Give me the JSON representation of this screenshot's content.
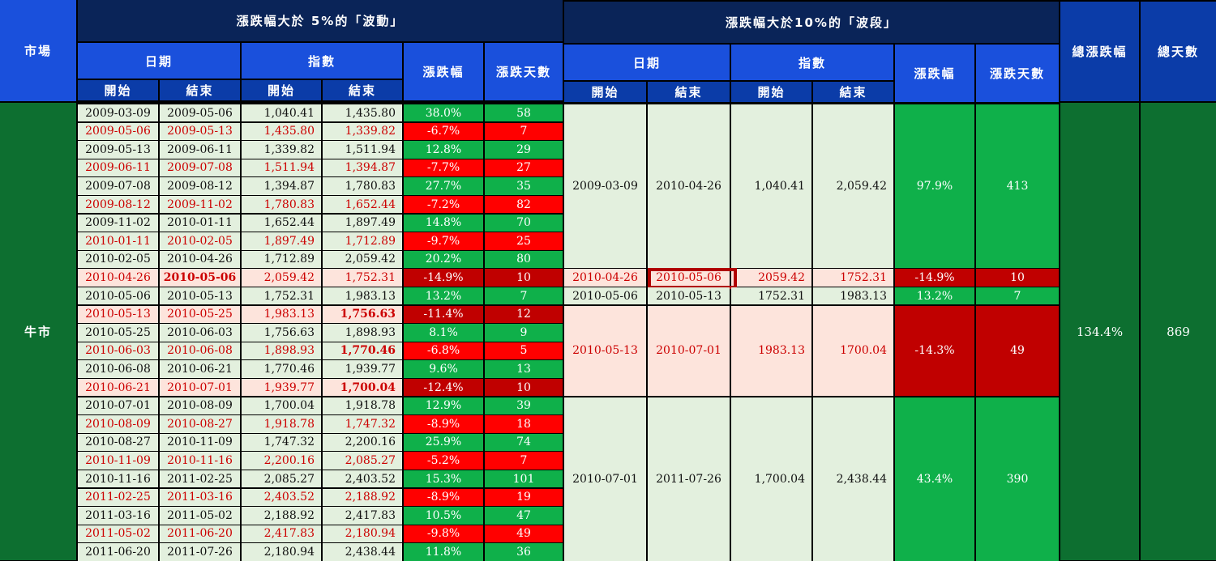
{
  "header": {
    "market": "市場",
    "left_group": "漲跌幅大於 5%的「波動」",
    "right_group": "漲跌幅大於10%的「波段」",
    "date": "日期",
    "index": "指數",
    "change": "漲跌幅",
    "days": "漲跌天數",
    "start": "開始",
    "end": "結束",
    "total_change": "總漲跌幅",
    "total_days": "總天數"
  },
  "market_label": "牛市",
  "totals": {
    "change": "134.4%",
    "days": "869"
  },
  "left_rows": [
    {
      "s": "2009-03-09",
      "e": "2009-05-06",
      "is": "1,040.41",
      "ie": "1,435.80",
      "chg": "38.0%",
      "d": "58",
      "type": "up"
    },
    {
      "s": "2009-05-06",
      "e": "2009-05-13",
      "is": "1,435.80",
      "ie": "1,339.82",
      "chg": "-6.7%",
      "d": "7",
      "type": "down"
    },
    {
      "s": "2009-05-13",
      "e": "2009-06-11",
      "is": "1,339.82",
      "ie": "1,511.94",
      "chg": "12.8%",
      "d": "29",
      "type": "up"
    },
    {
      "s": "2009-06-11",
      "e": "2009-07-08",
      "is": "1,511.94",
      "ie": "1,394.87",
      "chg": "-7.7%",
      "d": "27",
      "type": "down"
    },
    {
      "s": "2009-07-08",
      "e": "2009-08-12",
      "is": "1,394.87",
      "ie": "1,780.83",
      "chg": "27.7%",
      "d": "35",
      "type": "up"
    },
    {
      "s": "2009-08-12",
      "e": "2009-11-02",
      "is": "1,780.83",
      "ie": "1,652.44",
      "chg": "-7.2%",
      "d": "82",
      "type": "down"
    },
    {
      "s": "2009-11-02",
      "e": "2010-01-11",
      "is": "1,652.44",
      "ie": "1,897.49",
      "chg": "14.8%",
      "d": "70",
      "type": "up"
    },
    {
      "s": "2010-01-11",
      "e": "2010-02-05",
      "is": "1,897.49",
      "ie": "1,712.89",
      "chg": "-9.7%",
      "d": "25",
      "type": "down"
    },
    {
      "s": "2010-02-05",
      "e": "2010-04-26",
      "is": "1,712.89",
      "ie": "2,059.42",
      "chg": "20.2%",
      "d": "80",
      "type": "up"
    },
    {
      "s": "2010-04-26",
      "e": "2010-05-06",
      "is": "2,059.42",
      "ie": "1,752.31",
      "chg": "-14.9%",
      "d": "10",
      "type": "big",
      "bold": "e"
    },
    {
      "s": "2010-05-06",
      "e": "2010-05-13",
      "is": "1,752.31",
      "ie": "1,983.13",
      "chg": "13.2%",
      "d": "7",
      "type": "up"
    },
    {
      "s": "2010-05-13",
      "e": "2010-05-25",
      "is": "1,983.13",
      "ie": "1,756.63",
      "chg": "-11.4%",
      "d": "12",
      "type": "big",
      "bold": "ie"
    },
    {
      "s": "2010-05-25",
      "e": "2010-06-03",
      "is": "1,756.63",
      "ie": "1,898.93",
      "chg": "8.1%",
      "d": "9",
      "type": "up"
    },
    {
      "s": "2010-06-03",
      "e": "2010-06-08",
      "is": "1,898.93",
      "ie": "1,770.46",
      "chg": "-6.8%",
      "d": "5",
      "type": "down",
      "bold": "ie"
    },
    {
      "s": "2010-06-08",
      "e": "2010-06-21",
      "is": "1,770.46",
      "ie": "1,939.77",
      "chg": "9.6%",
      "d": "13",
      "type": "up"
    },
    {
      "s": "2010-06-21",
      "e": "2010-07-01",
      "is": "1,939.77",
      "ie": "1,700.04",
      "chg": "-12.4%",
      "d": "10",
      "type": "big",
      "bold": "ie"
    },
    {
      "s": "2010-07-01",
      "e": "2010-08-09",
      "is": "1,700.04",
      "ie": "1,918.78",
      "chg": "12.9%",
      "d": "39",
      "type": "up"
    },
    {
      "s": "2010-08-09",
      "e": "2010-08-27",
      "is": "1,918.78",
      "ie": "1,747.32",
      "chg": "-8.9%",
      "d": "18",
      "type": "down"
    },
    {
      "s": "2010-08-27",
      "e": "2010-11-09",
      "is": "1,747.32",
      "ie": "2,200.16",
      "chg": "25.9%",
      "d": "74",
      "type": "up"
    },
    {
      "s": "2010-11-09",
      "e": "2010-11-16",
      "is": "2,200.16",
      "ie": "2,085.27",
      "chg": "-5.2%",
      "d": "7",
      "type": "down"
    },
    {
      "s": "2010-11-16",
      "e": "2011-02-25",
      "is": "2,085.27",
      "ie": "2,403.52",
      "chg": "15.3%",
      "d": "101",
      "type": "up"
    },
    {
      "s": "2011-02-25",
      "e": "2011-03-16",
      "is": "2,403.52",
      "ie": "2,188.92",
      "chg": "-8.9%",
      "d": "19",
      "type": "down"
    },
    {
      "s": "2011-03-16",
      "e": "2011-05-02",
      "is": "2,188.92",
      "ie": "2,417.83",
      "chg": "10.5%",
      "d": "47",
      "type": "up"
    },
    {
      "s": "2011-05-02",
      "e": "2011-06-20",
      "is": "2,417.83",
      "ie": "2,180.94",
      "chg": "-9.8%",
      "d": "49",
      "type": "down"
    },
    {
      "s": "2011-06-20",
      "e": "2011-07-26",
      "is": "2,180.94",
      "ie": "2,438.44",
      "chg": "11.8%",
      "d": "36",
      "type": "up"
    }
  ],
  "right_rows": [
    {
      "s": "2009-03-09",
      "e": "2010-04-26",
      "is": "1,040.41",
      "ie": "2,059.42",
      "chg": "97.9%",
      "d": "413",
      "type": "up",
      "from": 0,
      "to": 8
    },
    {
      "s": "2010-04-26",
      "e": "2010-05-06",
      "is": "2059.42",
      "ie": "1752.31",
      "chg": "-14.9%",
      "d": "10",
      "type": "big",
      "from": 9,
      "to": 9,
      "highlight": true
    },
    {
      "s": "2010-05-06",
      "e": "2010-05-13",
      "is": "1752.31",
      "ie": "1983.13",
      "chg": "13.2%",
      "d": "7",
      "type": "up",
      "from": 10,
      "to": 10
    },
    {
      "s": "2010-05-13",
      "e": "2010-07-01",
      "is": "1983.13",
      "ie": "1700.04",
      "chg": "-14.3%",
      "d": "49",
      "type": "big",
      "from": 11,
      "to": 15
    },
    {
      "s": "2010-07-01",
      "e": "2011-07-26",
      "is": "1,700.04",
      "ie": "2,438.44",
      "chg": "43.4%",
      "d": "390",
      "type": "up",
      "from": 16,
      "to": 24
    }
  ]
}
